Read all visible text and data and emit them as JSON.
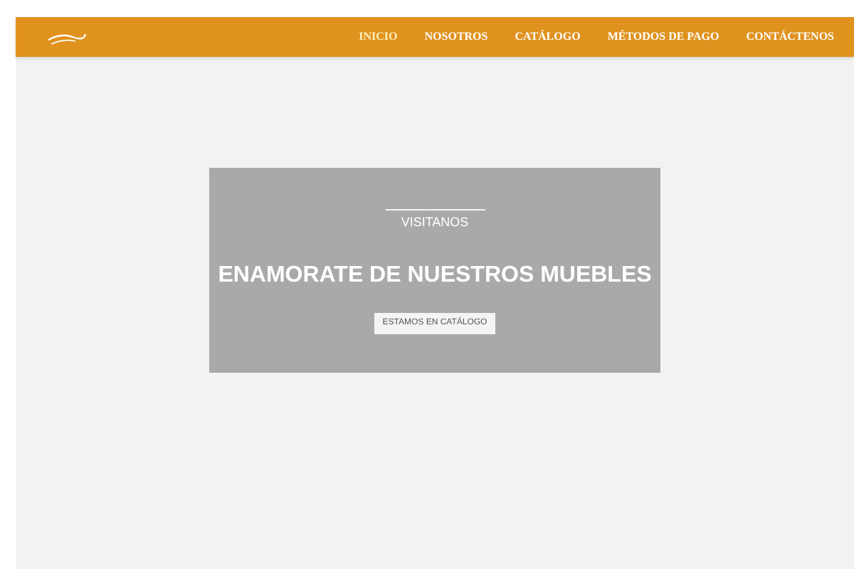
{
  "nav": {
    "items": [
      {
        "label": "INICIO",
        "selected": true
      },
      {
        "label": "NOSOTROS",
        "selected": false
      },
      {
        "label": "CATÁLOGO",
        "selected": false
      },
      {
        "label": "MÉTODOS DE PAGO",
        "selected": false
      },
      {
        "label": "CONTÁCTENOS",
        "selected": false
      }
    ]
  },
  "hero": {
    "eyebrow": "VISITANOS",
    "title": "ENAMORATE DE NUESTROS MUEBLES",
    "button": "ESTAMOS EN CATÁLOGO"
  }
}
